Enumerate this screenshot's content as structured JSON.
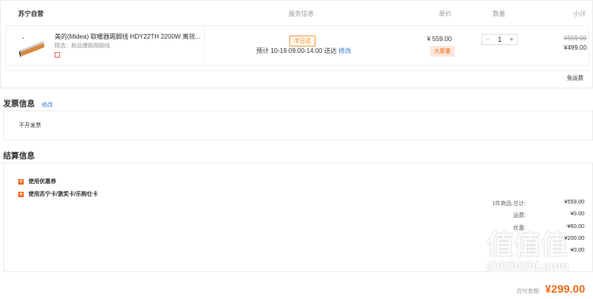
{
  "header": {
    "store": "苏宁自营",
    "service": "服务信息",
    "unit_price": "单价",
    "quantity": "数量",
    "subtotal": "小计"
  },
  "item": {
    "title": "美的(Midea) 取暖器踢脚线 HDY22TH 2200W 离效...",
    "selected_label": "精选：",
    "selected_value": "新品爆款踢脚线",
    "service_badge": "半日达",
    "delivery": "预计 10-19 09:00-14:00 送达",
    "modify": "修改",
    "price": "¥ 559.00",
    "promo_badge": "大聚惠",
    "qty": "1",
    "qty_minus": "−",
    "qty_plus": "+",
    "original_subtotal": "¥559.00",
    "subtotal": "¥499.00",
    "shipping": "免运费"
  },
  "invoice": {
    "title": "发票信息",
    "modify": "修改",
    "value": "不开发票"
  },
  "settlement": {
    "title": "结算信息",
    "coupon": "使用优惠券",
    "cards": "使用苏宁卡/激奖卡/乐购仕卡",
    "rows": [
      {
        "label": "1件商品 总计:",
        "value": "¥559.00"
      },
      {
        "label": "运费:",
        "value": "¥0.00"
      },
      {
        "label": "优惠:",
        "value": "-¥60.00"
      },
      {
        "label": "",
        "value": "¥200.00"
      },
      {
        "label": "",
        "value": "¥0.00"
      }
    ],
    "payable_label": "应付金额:",
    "payable": "¥299.00"
  },
  "watermark": "值 什么值得买 zhizhizhi.com"
}
